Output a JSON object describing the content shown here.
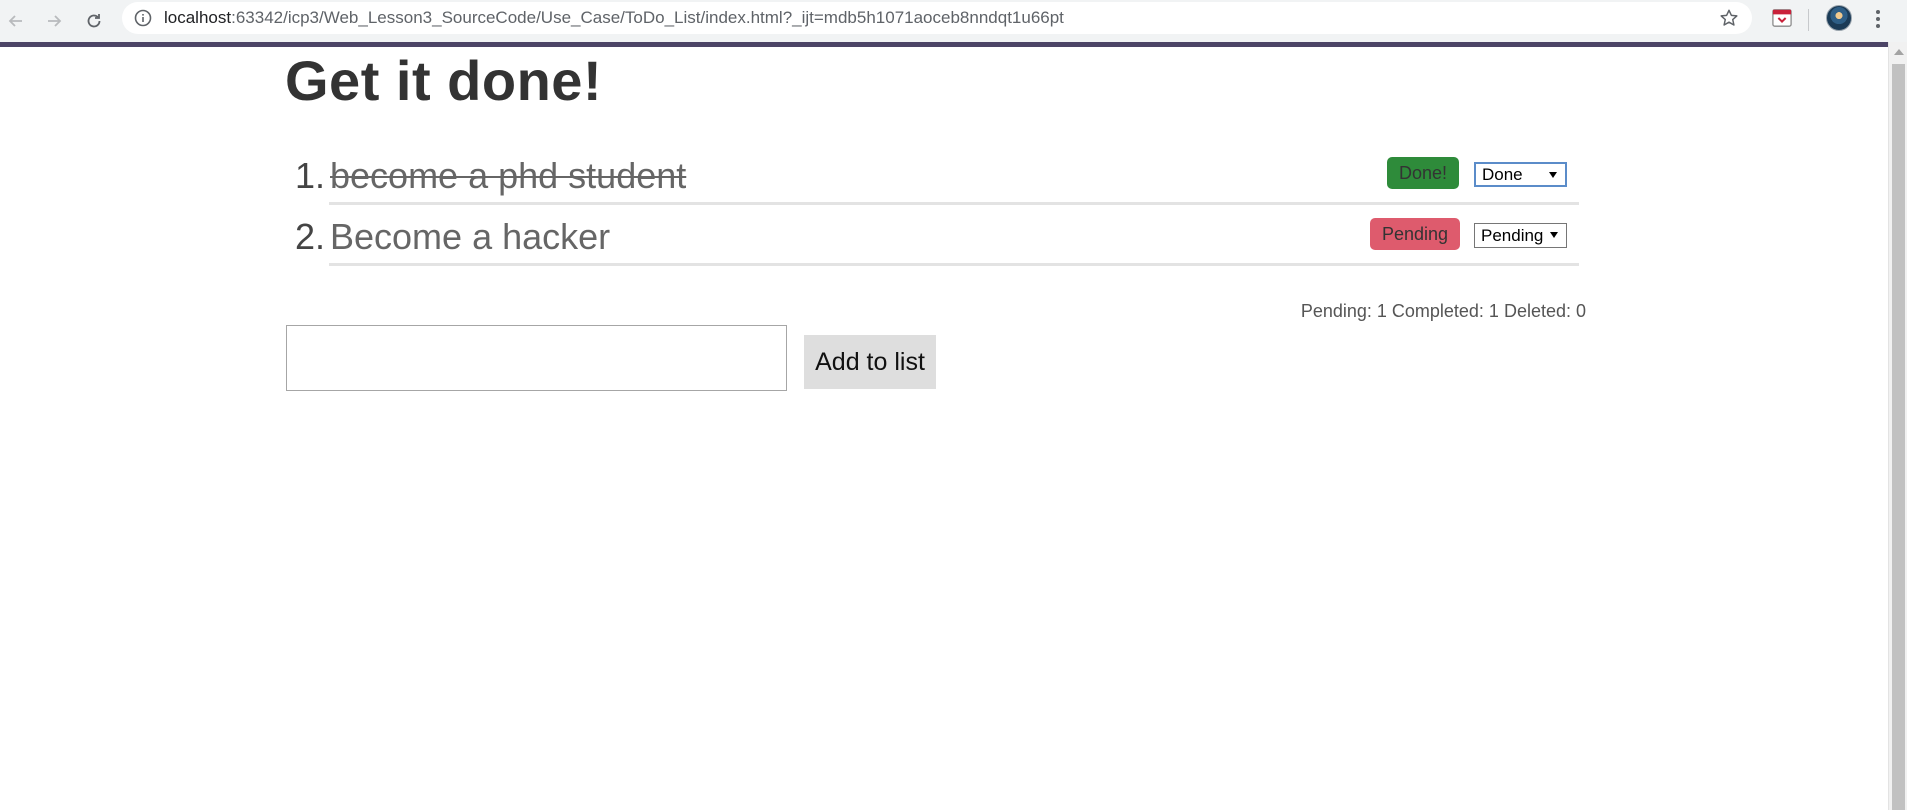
{
  "browser": {
    "url_host": "localhost",
    "url_path": ":63342/icp3/Web_Lesson3_SourceCode/Use_Case/ToDo_List/index.html?_ijt=mdb5h1071aoceb8nndqt1u66pt",
    "icons": [
      "back-arrow-icon",
      "forward-arrow-icon",
      "reload-icon",
      "info-icon",
      "star-icon",
      "extension-icon",
      "avatar",
      "kebab-menu-icon"
    ]
  },
  "page": {
    "title": "Get it done!"
  },
  "todos": [
    {
      "number": "1.",
      "text": "become a phd student",
      "completed": true,
      "status_label": "Done!",
      "status_color": "#2e8b3a",
      "select_value": "Done"
    },
    {
      "number": "2.",
      "text": "Become a hacker",
      "completed": false,
      "status_label": "Pending",
      "status_color": "#de5b6d",
      "select_value": "Pending"
    }
  ],
  "counts": {
    "text": "Pending: 1 Completed: 1 Deleted: 0"
  },
  "form": {
    "input_value": "",
    "add_label": "Add to list"
  },
  "colors": {
    "accent_bar": "#4c4466",
    "done_button": "#2e8b3a",
    "pending_button": "#de5b6d"
  }
}
